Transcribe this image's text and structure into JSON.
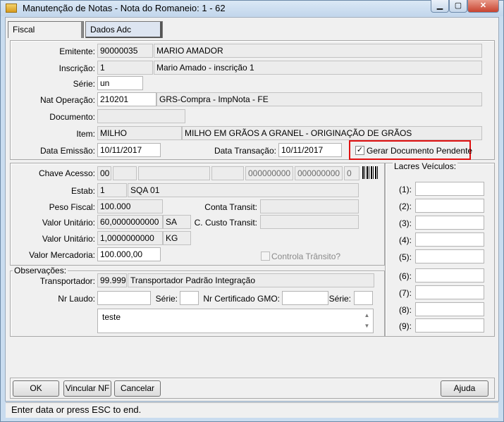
{
  "window": {
    "title": "Manutenção de Notas - Nota do Romaneio: 1 - 62"
  },
  "tabs": [
    {
      "label": "Fiscal"
    },
    {
      "label": "Dados Adc"
    }
  ],
  "header": {
    "emitente_label": "Emitente:",
    "emitente_code": "90000035",
    "emitente_name": "MARIO AMADOR",
    "inscricao_label": "Inscrição:",
    "inscricao_code": "1",
    "inscricao_name": "Mario Amado - inscrição 1",
    "serie_label": "Série:",
    "serie_value": "un",
    "natop_label": "Nat Operação:",
    "natop_code": "210201",
    "natop_desc": "GRS-Compra - ImpNota - FE",
    "documento_label": "Documento:",
    "documento_value": "",
    "item_label": "Item:",
    "item_code": "MILHO",
    "item_desc": "MILHO EM GRÃOS A GRANEL - ORIGINAÇÃO DE GRÃOS",
    "data_emissao_label": "Data Emissão:",
    "data_emissao": "10/11/2017",
    "data_transacao_label": "Data Transação:",
    "data_transacao": "10/11/2017",
    "gerar_doc_label": "Gerar Documento Pendente",
    "gerar_doc_checked": true
  },
  "middle": {
    "chave_label": "Chave Acesso:",
    "chave_1": "00",
    "chave_2": "",
    "chave_3": "",
    "chave_4": "",
    "chave_5": "000000000",
    "chave_6": "000000000",
    "chave_7": "0",
    "estab_label": "Estab:",
    "estab_code": "1",
    "estab_name": "SQA 01",
    "peso_label": "Peso Fiscal:",
    "peso_value": "100.000",
    "conta_transit_label": "Conta Transit:",
    "conta_transit_value": "",
    "valor_unit1_label": "Valor Unitário:",
    "valor_unit1": "60,0000000000",
    "valor_unit1_unit": "SA",
    "custo_transit_label": "C. Custo Transit:",
    "custo_transit_value": "",
    "valor_unit2_label": "Valor Unitário:",
    "valor_unit2": "1,0000000000",
    "valor_unit2_unit": "KG",
    "valor_merc_label": "Valor Mercadoria:",
    "valor_merc": "100.000,00",
    "controla_label": "Controla Trânsito?"
  },
  "obs": {
    "group_label": "Observações:",
    "transportador_label": "Transportador:",
    "transportador_code": "99.999",
    "transportador_name": "Transportador Padrão Integração",
    "laudo_label": "Nr Laudo:",
    "laudo_value": "",
    "serie1_label": "Série:",
    "serie1_value": "",
    "gmo_label": "Nr Certificado GMO:",
    "gmo_value": "",
    "serie2_label": "Série:",
    "serie2_value": "",
    "text": "teste"
  },
  "lacres": {
    "label": "Lacres Veículos:",
    "items": [
      {
        "label": "(1):"
      },
      {
        "label": "(2):"
      },
      {
        "label": "(3):"
      },
      {
        "label": "(4):"
      },
      {
        "label": "(5):"
      },
      {
        "label": "(6):"
      },
      {
        "label": "(7):"
      },
      {
        "label": "(8):"
      },
      {
        "label": "(9):"
      }
    ]
  },
  "buttons": {
    "ok": "OK",
    "vincular": "Vincular NF",
    "cancelar": "Cancelar",
    "ajuda": "Ajuda"
  },
  "status": {
    "text": "Enter data or press ESC to end."
  },
  "colors": {
    "highlight": "#e01010",
    "window_frame": "#c9dcef",
    "client_bg": "#f0f0f0"
  }
}
